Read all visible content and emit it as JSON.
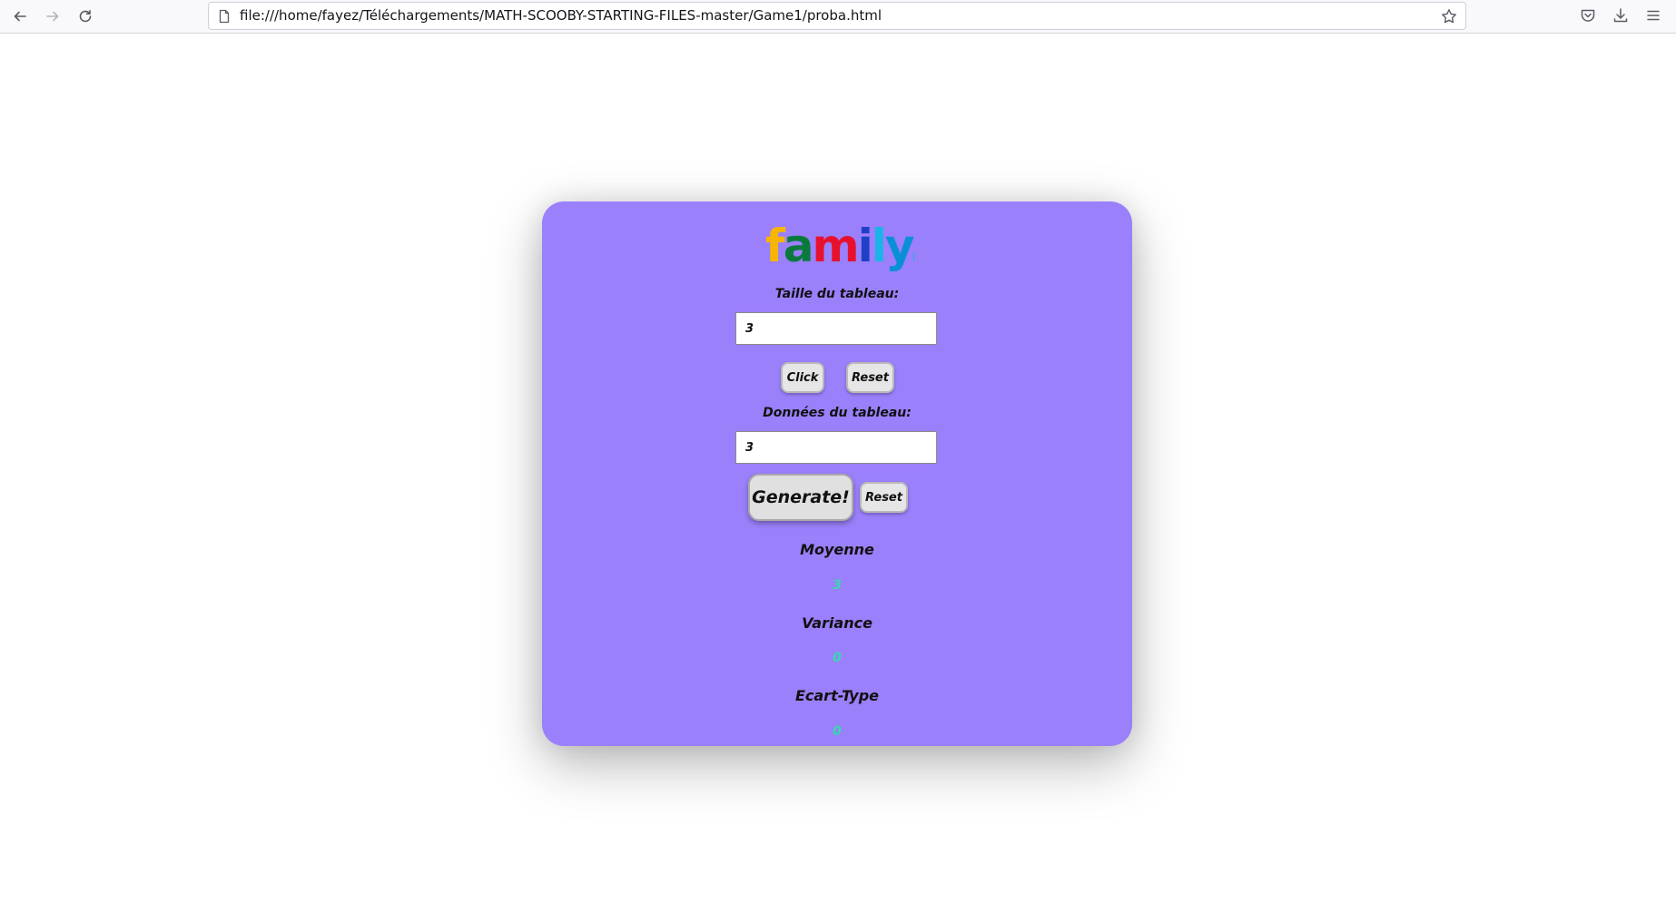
{
  "browser": {
    "url": "file:///home/fayez/Téléchargements/MATH-SCOOBY-STARTING-FILES-master/Game1/proba.html",
    "icons": {
      "back": "arrow-left-icon",
      "forward": "arrow-right-icon",
      "reload": "reload-icon",
      "page": "page-icon",
      "bookmark": "star-icon",
      "pocket": "pocket-icon",
      "downloads": "download-icon",
      "menu": "hamburger-menu-icon"
    }
  },
  "app": {
    "logo_text": "family.",
    "logo_colors": {
      "f": "#f7b500",
      "a": "#0a7a3c",
      "m": "#e8112d",
      "i": "#1e40c8",
      "l": "#19b5e6",
      "y": "#0a8fd6",
      "dot": "#19b5e6"
    },
    "card_color": "#9a80fa",
    "value_color": "#35d9b0",
    "size_section": {
      "label": "Taille du tableau:",
      "value": "3",
      "click_label": "Click",
      "reset_label": "Reset"
    },
    "data_section": {
      "label": "Données du tableau:",
      "value": "3",
      "generate_label": "Generate!",
      "reset_label": "Reset"
    },
    "stats": {
      "mean_title": "Moyenne",
      "mean_value": "3",
      "variance_title": "Variance",
      "variance_value": "0",
      "stddev_title": "Ecart-Type",
      "stddev_value": "0"
    }
  }
}
